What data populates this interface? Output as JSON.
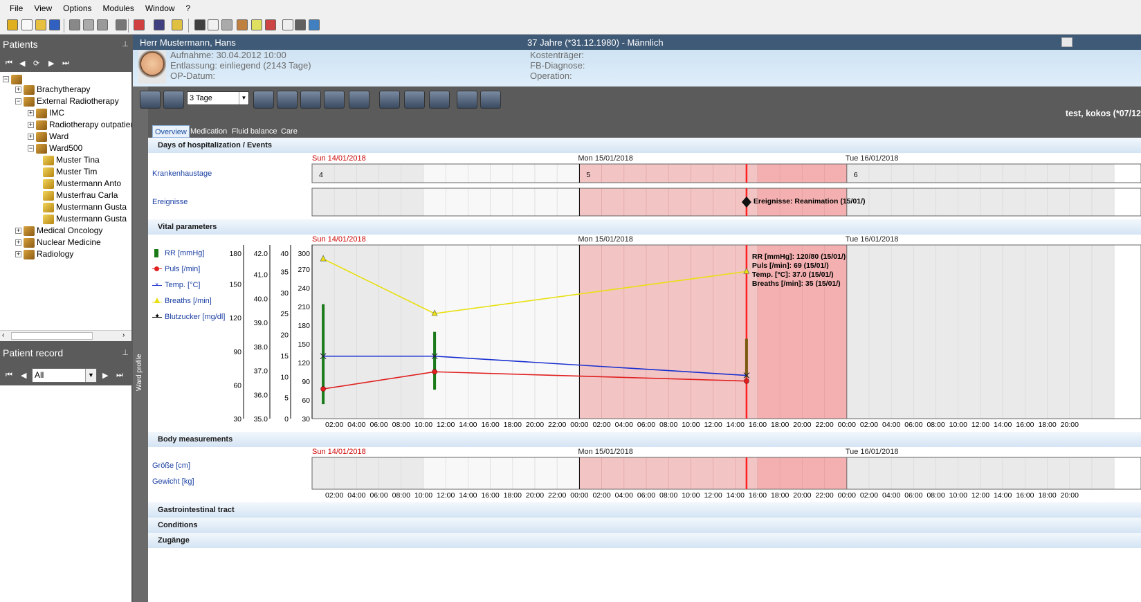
{
  "menu": {
    "items": [
      "File",
      "View",
      "Options",
      "Modules",
      "Window",
      "?"
    ]
  },
  "toolbar_icons": [
    "key-icon",
    "new-document-icon",
    "open-folder-icon",
    "save-icon",
    "print-icon",
    "print-preview-icon",
    "print-setup-icon",
    "copy-icon",
    "cancel-icon",
    "lock-icon",
    "user-icon",
    "measure-icon",
    "note-icon",
    "record-icon",
    "calendar-icon",
    "image-icon",
    "clipboard-icon",
    "edit-icon",
    "tools-icon",
    "table-icon"
  ],
  "patients_pane": {
    "title": "Patients",
    "tree": [
      {
        "label": "Brachytherapy",
        "level": 1,
        "expander": "+"
      },
      {
        "label": "External Radiotherapy",
        "level": 1,
        "expander": "-"
      },
      {
        "label": "IMC",
        "level": 2,
        "expander": "+"
      },
      {
        "label": "Radiotherapy outpatien",
        "level": 2,
        "expander": "+"
      },
      {
        "label": "Ward",
        "level": 2,
        "expander": "+"
      },
      {
        "label": "Ward500",
        "level": 2,
        "expander": "-"
      },
      {
        "label": "Muster Tina",
        "level": 3,
        "expander": ""
      },
      {
        "label": "Muster Tim",
        "level": 3,
        "expander": ""
      },
      {
        "label": "Mustermann Anto",
        "level": 3,
        "expander": ""
      },
      {
        "label": "Musterfrau Carla",
        "level": 3,
        "expander": ""
      },
      {
        "label": "Mustermann Gusta",
        "level": 3,
        "expander": ""
      },
      {
        "label": "Mustermann Gusta",
        "level": 3,
        "expander": ""
      },
      {
        "label": "Medical Oncology",
        "level": 1,
        "expander": "+"
      },
      {
        "label": "Nuclear Medicine",
        "level": 1,
        "expander": "+"
      },
      {
        "label": "Radiology",
        "level": 1,
        "expander": "+"
      }
    ]
  },
  "patient_record_pane": {
    "title": "Patient record",
    "filter_value": "All"
  },
  "patient_header": {
    "name": "Herr Mustermann, Hans",
    "age_info": "37 Jahre (*31.12.1980) - Männlich",
    "aufnahme": "Aufnahme: 30.04.2012 10:00",
    "entlassung": "Entlassung: einliegend (2143 Tage)",
    "op_datum": "OP-Datum:",
    "kostentraeger": "Kostenträger:",
    "fb_diagnose": "FB-Diagnose:",
    "operation": "Operation:"
  },
  "view_toolbar": {
    "range_value": "3 Tage",
    "user_text": "test, kokos (*07/12"
  },
  "side_strip": {
    "label": "Ward profile"
  },
  "tabs": [
    "Overview",
    "Medication",
    "Fluid balance",
    "Care"
  ],
  "sections": {
    "days": "Days of hospitalization / Events",
    "vital": "Vital parameters",
    "body": "Body measurements",
    "gi": "Gastrointestinal tract",
    "conditions": "Conditions",
    "zugaenge": "Zugänge"
  },
  "dates": [
    "Sun 14/01/2018",
    "Mon 15/01/2018",
    "Tue 16/01/2018"
  ],
  "hours": [
    "02:00",
    "04:00",
    "06:00",
    "08:00",
    "10:00",
    "12:00",
    "14:00",
    "16:00",
    "18:00",
    "20:00",
    "22:00",
    "00:00",
    "02:00",
    "04:00",
    "06:00",
    "08:00",
    "10:00",
    "12:00",
    "14:00",
    "16:00",
    "18:00",
    "20:00",
    "22:00",
    "00:00",
    "02:00",
    "04:00",
    "06:00",
    "08:00",
    "10:00",
    "12:00",
    "14:00",
    "16:00",
    "18:00",
    "20:00"
  ],
  "days_rows": {
    "krankenhaustage_label": "Krankenhaustage",
    "ereignisse_label": "Ereignisse",
    "day_numbers": [
      "4",
      "5",
      "6"
    ],
    "event_text": "Ereignisse: Reanimation (15/01/)"
  },
  "body_rows": {
    "groesse_label": "Größe [cm]",
    "gewicht_label": "Gewicht [kg]"
  },
  "legend": [
    {
      "label": "RR [mmHg]",
      "color": "#1a7a1a",
      "icon": "bar-icon"
    },
    {
      "label": "Puls [/min]",
      "color": "#e02020",
      "icon": "dot-icon"
    },
    {
      "label": "Temp. [°C]",
      "color": "#1a2fd0",
      "icon": "cross-icon"
    },
    {
      "label": "Breaths [/min]",
      "color": "#e8e010",
      "icon": "triangle-icon"
    },
    {
      "label": "Blutzucker [mg/dl]",
      "color": "#000000",
      "icon": "star-icon"
    }
  ],
  "tooltip": [
    "RR [mmHg]: 120/80 (15/01/)",
    "Puls [/min]: 69 (15/01/)",
    "Temp. [°C]: 37.0 (15/01/)",
    "Breaths [/min]: 35 (15/01/)"
  ],
  "colors": {
    "highlight_day": "#f4c4c4",
    "current_time_line": "#ff2020"
  },
  "chart_data": {
    "type": "line",
    "x_unit": "hours from Sun 14/01/2018 00:00",
    "x_range": [
      0,
      72
    ],
    "axes": {
      "rr_puls": {
        "ticks": [
          30,
          60,
          90,
          120,
          150,
          180
        ]
      },
      "temp": {
        "ticks": [
          "35.0",
          "36.0",
          "37.0",
          "38.0",
          "39.0",
          "40.0",
          "41.0",
          "42.0"
        ]
      },
      "breaths": {
        "ticks": [
          0,
          5,
          10,
          15,
          20,
          25,
          30,
          35,
          40
        ]
      },
      "blutzucker": {
        "ticks": [
          30,
          60,
          90,
          120,
          150,
          180,
          210,
          240,
          270,
          300
        ]
      }
    },
    "series": [
      {
        "name": "Breaths [/min]",
        "color": "#e8e010",
        "x": [
          1,
          11,
          39
        ],
        "y": [
          38,
          25,
          35
        ]
      },
      {
        "name": "Temp. [°C]",
        "color": "#1a2fd0",
        "x": [
          1,
          11,
          39
        ],
        "y": [
          37.6,
          37.6,
          36.8
        ]
      },
      {
        "name": "Puls [/min]",
        "color": "#e02020",
        "x": [
          1,
          11,
          39
        ],
        "y": [
          45,
          75,
          69
        ]
      },
      {
        "name": "RR [mmHg]",
        "color": "#1a7a1a",
        "x": [
          1,
          11,
          39
        ],
        "high": [
          120,
          120,
          120
        ],
        "low": [
          45,
          60,
          80
        ]
      }
    ],
    "current_time": 39
  }
}
